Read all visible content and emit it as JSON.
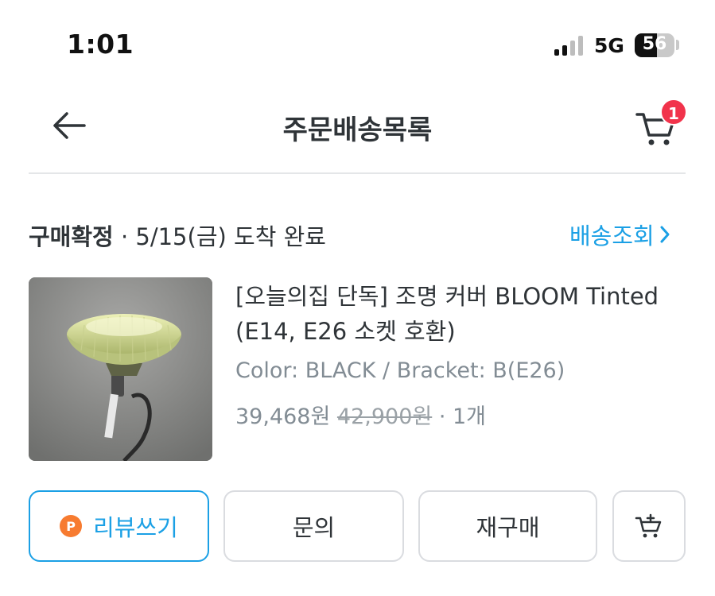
{
  "status_bar": {
    "time": "1:01",
    "network": "5G",
    "battery": "56"
  },
  "header": {
    "title": "주문배송목록",
    "cart_count": "1"
  },
  "order": {
    "status_strong": "구매확정",
    "status_detail": " · 5/15(금) 도착 완료",
    "tracking_label": "배송조회",
    "product": {
      "title": "[오늘의집 단독] 조명 커버 BLOOM Tinted (E14, E26 소켓 호환)",
      "option": "Color: BLACK / Bracket: B(E26)",
      "price": "39,468원",
      "original_price": "42,900원",
      "quantity": " · 1개"
    }
  },
  "actions": {
    "review_badge": "P",
    "review": "리뷰쓰기",
    "inquiry": "문의",
    "rebuy": "재구매"
  },
  "colors": {
    "accent": "#1ba0e5",
    "badge": "#f1334b",
    "point": "#f77b30"
  }
}
